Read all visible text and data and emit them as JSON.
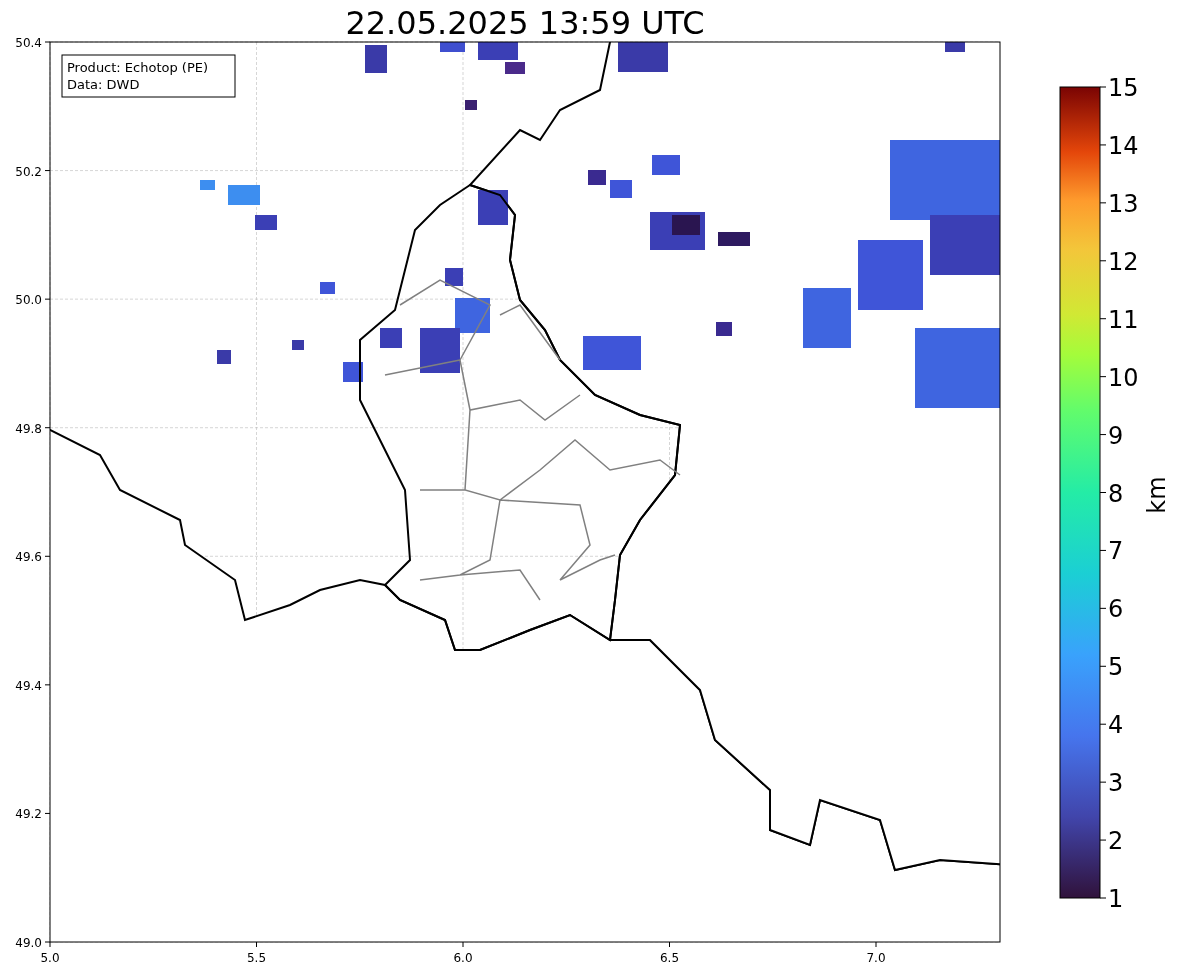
{
  "title": "22.05.2025 13:59 UTC",
  "info_box": [
    "Product: Echotop (PE)",
    "Data: DWD"
  ],
  "map": {
    "x_ticks": [
      "5.0",
      "5.5",
      "6.0",
      "6.5",
      "7.0"
    ],
    "y_ticks": [
      "50.4",
      "50.2",
      "50.0",
      "49.8",
      "49.6",
      "49.4",
      "49.2",
      "49.0"
    ]
  },
  "colorbar": {
    "label": "km",
    "ticks": [
      "15",
      "14",
      "13",
      "12",
      "11",
      "10",
      "9",
      "8",
      "7",
      "6",
      "5",
      "4",
      "3",
      "2",
      "1"
    ]
  }
}
